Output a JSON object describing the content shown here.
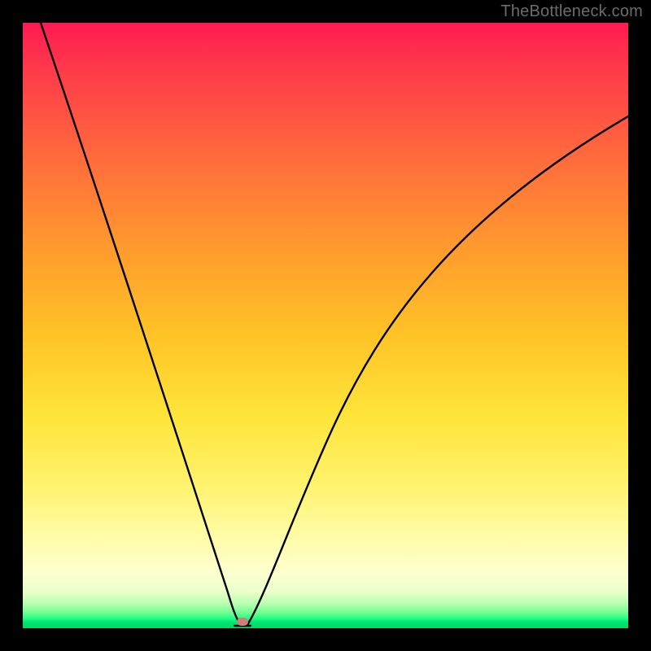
{
  "watermark": {
    "text": "TheBottleneck.com"
  },
  "chart_data": {
    "type": "line",
    "title": "",
    "xlabel": "",
    "ylabel": "",
    "xlim": [
      0,
      100
    ],
    "ylim": [
      0,
      100
    ],
    "grid": false,
    "legend": false,
    "background": {
      "type": "vertical-gradient",
      "stops": [
        {
          "pct": 0,
          "color": "#ff1a52"
        },
        {
          "pct": 22,
          "color": "#ff6a3d"
        },
        {
          "pct": 52,
          "color": "#ffc427"
        },
        {
          "pct": 76,
          "color": "#fff26b"
        },
        {
          "pct": 94,
          "color": "#eaffcb"
        },
        {
          "pct": 100,
          "color": "#00d968"
        }
      ]
    },
    "series": [
      {
        "name": "bottleneck-curve",
        "color": "#000000",
        "x": [
          3,
          6,
          9,
          12,
          15,
          18,
          21,
          24,
          27,
          30,
          31.5,
          33,
          34.5,
          35.5,
          36,
          37,
          40,
          44,
          48,
          53,
          58,
          64,
          70,
          77,
          85,
          93,
          100
        ],
        "values": [
          100,
          89,
          79,
          69,
          60,
          51,
          43,
          35,
          27,
          18,
          12,
          7,
          3,
          1,
          0,
          2,
          9,
          18,
          27,
          36,
          44,
          52,
          60,
          67,
          74,
          80,
          85
        ]
      }
    ],
    "marker": {
      "name": "optimal-point",
      "x": 36,
      "y": 0,
      "color": "#cf7f77"
    }
  }
}
